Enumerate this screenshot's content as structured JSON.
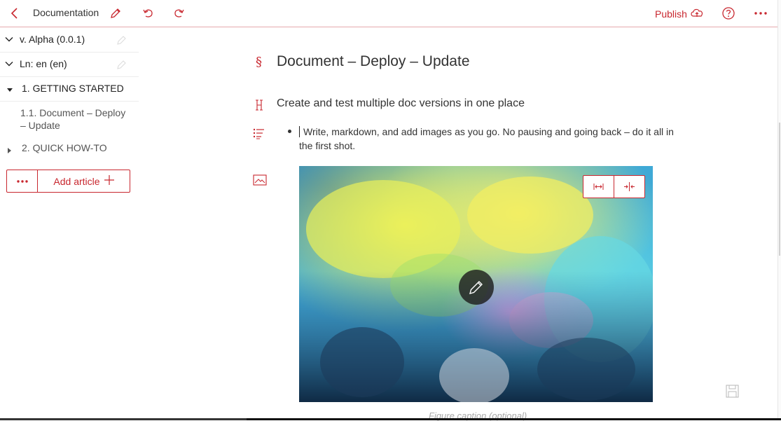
{
  "topbar": {
    "back_icon": "chevron-left-icon",
    "title": "Documentation",
    "edit_icon": "pencil-icon",
    "undo_icon": "undo-icon",
    "redo_icon": "redo-icon",
    "publish_label": "Publish",
    "publish_icon": "cloud-upload-icon",
    "help_icon": "help-circle-icon",
    "more_icon": "more-horizontal-icon"
  },
  "sidebar": {
    "version_label": "v. Alpha (0.0.1)",
    "language_label": "Ln: en (en)",
    "sections": [
      {
        "label": "1. GETTING STARTED",
        "expanded": true,
        "articles": [
          {
            "label": "1.1. Document – Deploy – Update"
          }
        ]
      },
      {
        "label": "2. QUICK HOW-TO",
        "expanded": false,
        "articles": []
      }
    ],
    "add_article_label": "Add article"
  },
  "editor": {
    "h1": "Document – Deploy – Update",
    "h2": "Create and test multiple doc versions in one place",
    "bullet": "Write, markdown, and add images as you go. No pausing and going back – do it all in the first shot.",
    "figure_caption_placeholder": "Figure caption (optional)",
    "block_icons": [
      "section-icon",
      "heading-icon",
      "list-icon",
      "image-icon"
    ]
  },
  "colors": {
    "accent": "#c8272f",
    "border": "#e5a9ac",
    "text": "#333333"
  }
}
